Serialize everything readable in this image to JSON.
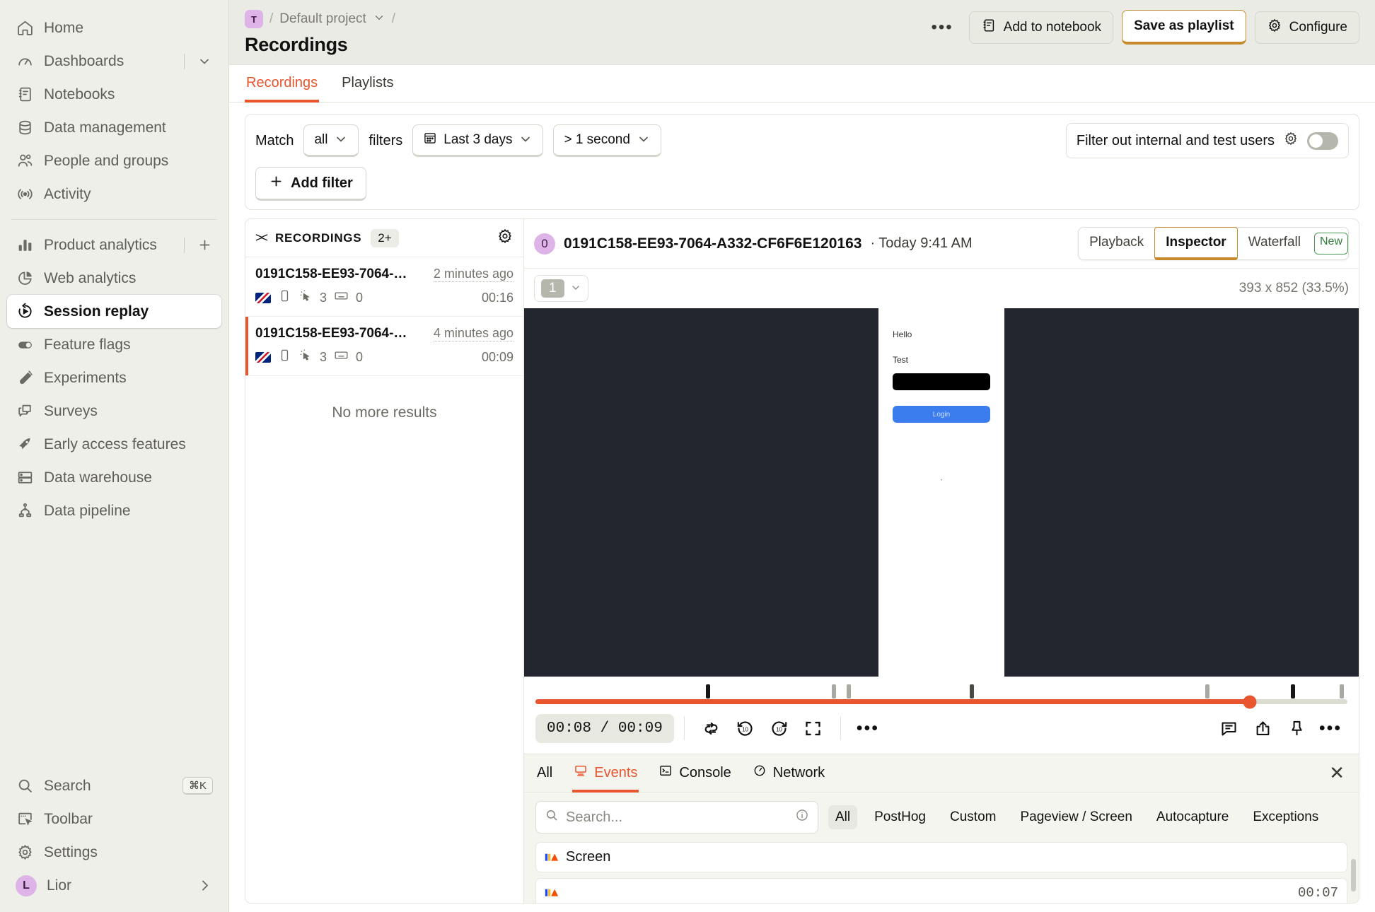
{
  "sidebar": {
    "items": [
      {
        "label": "Home",
        "icon": "home-icon"
      },
      {
        "label": "Dashboards",
        "icon": "gauge-icon",
        "trailing": "chevron-down-icon"
      },
      {
        "label": "Notebooks",
        "icon": "notebook-icon"
      },
      {
        "label": "Data management",
        "icon": "database-icon"
      },
      {
        "label": "People and groups",
        "icon": "people-icon"
      },
      {
        "label": "Activity",
        "icon": "broadcast-icon"
      }
    ],
    "items2": [
      {
        "label": "Product analytics",
        "icon": "bar-chart-icon",
        "trailing": "plus-icon"
      },
      {
        "label": "Web analytics",
        "icon": "pie-chart-icon"
      },
      {
        "label": "Session replay",
        "icon": "replay-icon",
        "active": true
      },
      {
        "label": "Feature flags",
        "icon": "toggle-icon"
      },
      {
        "label": "Experiments",
        "icon": "flask-icon"
      },
      {
        "label": "Surveys",
        "icon": "chat-icon"
      },
      {
        "label": "Early access features",
        "icon": "rocket-icon"
      },
      {
        "label": "Data warehouse",
        "icon": "server-icon"
      },
      {
        "label": "Data pipeline",
        "icon": "pipeline-icon"
      }
    ],
    "bottom": [
      {
        "label": "Search",
        "icon": "search-icon",
        "shortcut": "⌘K"
      },
      {
        "label": "Toolbar",
        "icon": "toolbar-icon"
      },
      {
        "label": "Settings",
        "icon": "gear-icon"
      }
    ],
    "user": {
      "name": "Lior",
      "initial": "L",
      "trailing": "chevron-right-icon"
    }
  },
  "header": {
    "project_badge": "T",
    "project": "Default project",
    "title": "Recordings",
    "more_label": "•••",
    "add_to_notebook": "Add to notebook",
    "save_as_playlist": "Save as playlist",
    "configure": "Configure"
  },
  "tabs": [
    {
      "label": "Recordings",
      "active": true
    },
    {
      "label": "Playlists",
      "active": false
    }
  ],
  "filters": {
    "match_label": "Match",
    "match_value": "all",
    "filters_label": "filters",
    "date_range": "Last 3 days",
    "duration": "> 1 second",
    "add_filter": "Add filter",
    "internal_users_label": "Filter out internal and test users",
    "internal_users_on": false
  },
  "recordings_panel": {
    "title": "RECORDINGS",
    "count": "2+",
    "no_more": "No more results",
    "rows": [
      {
        "id": "0191C158-EE93-7064-…",
        "ago": "2 minutes ago",
        "clicks": "3",
        "keys": "0",
        "duration": "00:16",
        "selected": false
      },
      {
        "id": "0191C158-EE93-7064-…",
        "ago": "4 minutes ago",
        "clicks": "3",
        "keys": "0",
        "duration": "00:09",
        "selected": true
      }
    ]
  },
  "player": {
    "badge": "0",
    "session_id": "0191C158-EE93-7064-A332-CF6F6E120163",
    "session_time": "· Today 9:41 AM",
    "modes": [
      {
        "label": "Playback",
        "active": false
      },
      {
        "label": "Inspector",
        "active": true
      },
      {
        "label": "Waterfall",
        "active": false
      }
    ],
    "new_pill": "New",
    "window_number": "1",
    "dimensions": "393 x 852 (33.5%)",
    "screen": {
      "hello": "Hello",
      "test": "Test",
      "login": "Login"
    },
    "current_time": "00:08",
    "total_time": "00:09",
    "time_display": "00:08 / 00:09",
    "progress_percent": 83,
    "controls": [
      {
        "name": "loop-icon"
      },
      {
        "name": "skip-back-10-icon"
      },
      {
        "name": "skip-forward-10-icon"
      },
      {
        "name": "fullscreen-icon"
      },
      {
        "name": "more-icon"
      }
    ],
    "right_controls": [
      {
        "name": "comment-icon"
      },
      {
        "name": "share-icon"
      },
      {
        "name": "pin-icon"
      },
      {
        "name": "more-icon"
      }
    ]
  },
  "inspector": {
    "tabs": [
      {
        "label": "All",
        "icon": "",
        "active": false
      },
      {
        "label": "Events",
        "icon": "monitor-icon",
        "active": true
      },
      {
        "label": "Console",
        "icon": "console-icon",
        "active": false
      },
      {
        "label": "Network",
        "icon": "network-icon",
        "active": false
      }
    ],
    "search_placeholder": "Search...",
    "event_filters": [
      {
        "label": "All",
        "active": true
      },
      {
        "label": "PostHog",
        "active": false
      },
      {
        "label": "Custom",
        "active": false
      },
      {
        "label": "Pageview / Screen",
        "active": false
      },
      {
        "label": "Autocapture",
        "active": false
      },
      {
        "label": "Exceptions",
        "active": false
      }
    ],
    "events": [
      {
        "name": "Screen",
        "time": ""
      },
      {
        "name": "",
        "time": "00:07"
      }
    ]
  },
  "colors": {
    "accent": "#E8552E",
    "gold": "#C68A2C",
    "sidebar_bg": "#EEEFE9",
    "purple": "#DDB3E8"
  }
}
